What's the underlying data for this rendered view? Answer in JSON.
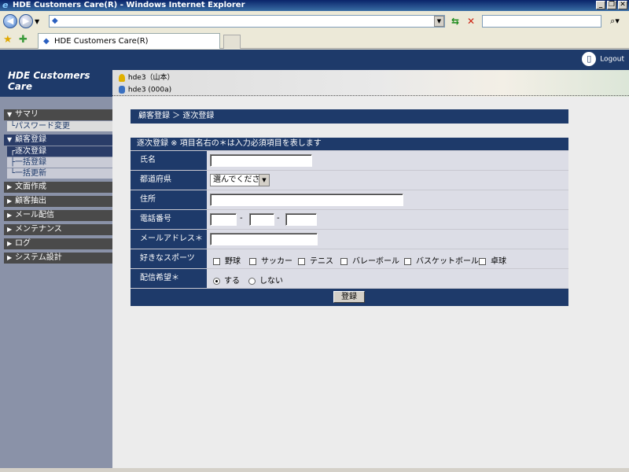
{
  "window": {
    "title": "HDE Customers Care(R) - Windows Internet Explorer",
    "tab_title": "HDE Customers Care(R)"
  },
  "header": {
    "brand": "HDE Customers Care",
    "logout_label": "Logout",
    "user_line1": "hde3（山本）",
    "user_line2": "hde3 (000a)"
  },
  "sidebar": {
    "sections": [
      {
        "label": "サマリ",
        "open": true,
        "items": [
          "パスワード変更"
        ]
      },
      {
        "label": "顧客登録",
        "open": true,
        "items": [
          "逐次登録",
          "一括登録",
          "一括更新"
        ]
      },
      {
        "label": "文面作成",
        "open": false
      },
      {
        "label": "顧客抽出",
        "open": false
      },
      {
        "label": "メール配信",
        "open": false
      },
      {
        "label": "メンテナンス",
        "open": false
      },
      {
        "label": "ログ",
        "open": false
      },
      {
        "label": "システム設計",
        "open": false
      }
    ]
  },
  "main": {
    "breadcrumb": "顧客登録 ＞ 逐次登録",
    "form_header": "逐次登録 ※ 項目名右の＊は入力必須項目を表します",
    "fields": {
      "name_label": "氏名",
      "pref_label": "都道府県",
      "pref_value": "選んでください",
      "address_label": "住所",
      "phone_label": "電話番号",
      "phone_sep": "-",
      "email_label": "メールアドレス＊",
      "sports_label": "好きなスポーツ",
      "sports": [
        "野球",
        "サッカー",
        "テニス",
        "バレーボール",
        "バスケットボール",
        "卓球"
      ],
      "delivery_label": "配信希望＊",
      "delivery_options": [
        "する",
        "しない"
      ],
      "delivery_selected": "する"
    },
    "submit_label": "登録"
  }
}
